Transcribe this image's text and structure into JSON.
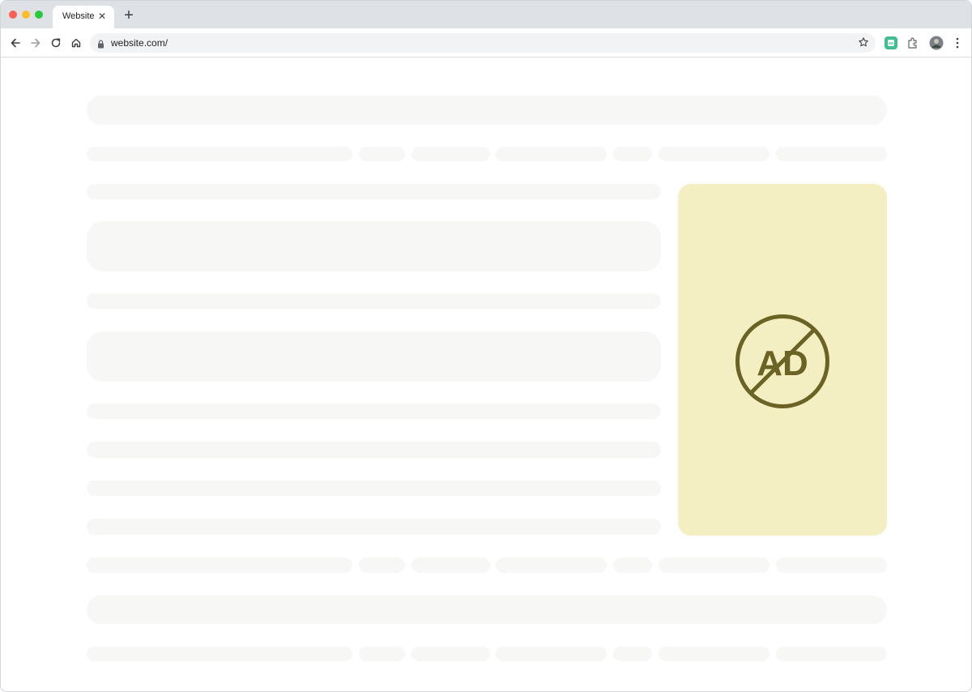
{
  "browser": {
    "tab": {
      "title": "Website"
    },
    "address_bar": {
      "url": "website.com/"
    }
  },
  "toolbar_icons": [
    "back-arrow-icon",
    "forward-arrow-icon",
    "reload-icon",
    "home-icon",
    "lock-icon",
    "star-icon",
    "extension-badge-icon",
    "puzzle-icon",
    "profile-avatar-icon",
    "kebab-menu-icon"
  ],
  "ad_block": {
    "label": "AD",
    "accent_color": "#6b6324",
    "background_color": "#f3efc3"
  },
  "colors": {
    "placeholder": "#f7f7f6",
    "tabstrip": "#dee1e6"
  }
}
